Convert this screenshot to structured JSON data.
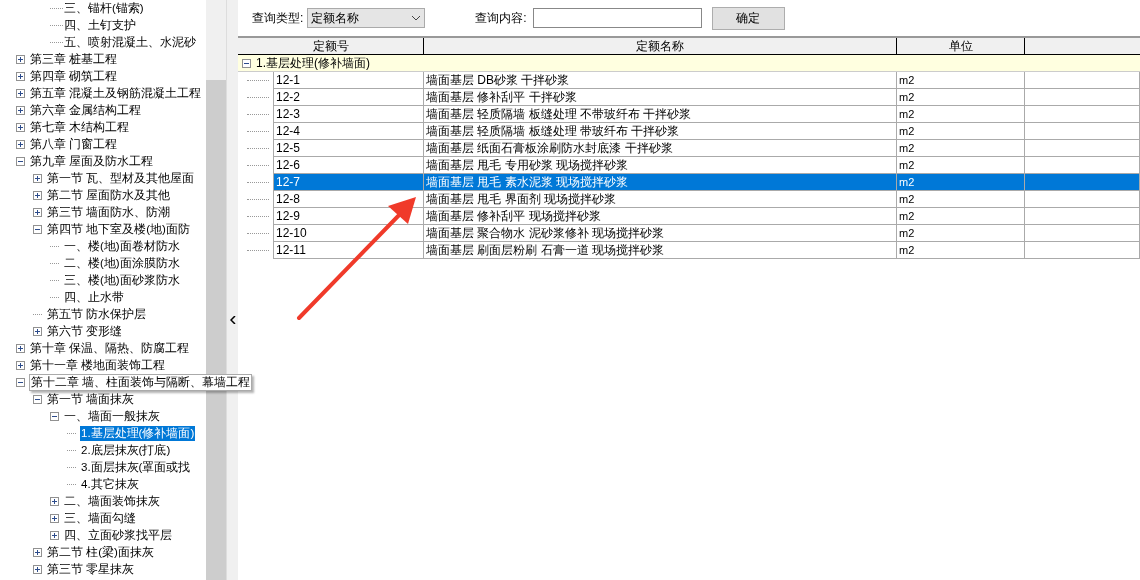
{
  "tree": {
    "scrolled_branch": [
      {
        "label": "三、锚杆(锚索)",
        "selected": false
      },
      {
        "label": "四、土钉支护",
        "selected": false
      },
      {
        "label": "五、喷射混凝土、水泥砂",
        "selected": false
      }
    ],
    "nodes": [
      {
        "label": "第三章 桩基工程",
        "expanded": false,
        "selected": false
      },
      {
        "label": "第四章 砌筑工程",
        "expanded": false,
        "selected": false
      },
      {
        "label": "第五章 混凝土及钢筋混凝土工程",
        "expanded": false,
        "selected": false
      },
      {
        "label": "第六章 金属结构工程",
        "expanded": false,
        "selected": false
      },
      {
        "label": "第七章 木结构工程",
        "expanded": false,
        "selected": false
      },
      {
        "label": "第八章 门窗工程",
        "expanded": false,
        "selected": false
      },
      {
        "label": "第九章 屋面及防水工程",
        "expanded": true,
        "selected": false,
        "children": [
          {
            "label": "第一节 瓦、型材及其他屋面",
            "expanded": false,
            "selected": false
          },
          {
            "label": "第二节 屋面防水及其他",
            "expanded": false,
            "selected": false
          },
          {
            "label": "第三节 墙面防水、防潮",
            "expanded": false,
            "selected": false
          },
          {
            "label": "第四节 地下室及楼(地)面防",
            "expanded": true,
            "selected": false,
            "children": [
              {
                "label": "一、楼(地)面卷材防水",
                "selected": false
              },
              {
                "label": "二、楼(地)面涂膜防水",
                "selected": false
              },
              {
                "label": "三、楼(地)面砂浆防水",
                "selected": false
              },
              {
                "label": "四、止水带",
                "selected": false
              }
            ]
          },
          {
            "label": "第五节 防水保护层",
            "selected": false
          },
          {
            "label": "第六节 变形缝",
            "expanded": false,
            "selected": false
          }
        ]
      },
      {
        "label": "第十章 保温、隔热、防腐工程",
        "expanded": false,
        "selected": false
      },
      {
        "label": "第十一章 楼地面装饰工程",
        "expanded": false,
        "selected": false
      },
      {
        "label": "第十二章 墙、柱面装饰与隔断、幕墙工程",
        "expanded": true,
        "selected": false,
        "tooltip": true,
        "children": [
          {
            "label": "第一节 墙面抹灰",
            "expanded": true,
            "selected": false,
            "children": [
              {
                "label": "一、墙面一般抹灰",
                "expanded": true,
                "selected": false,
                "children": [
                  {
                    "label": "1.基层处理(修补墙面)",
                    "selected": true
                  },
                  {
                    "label": "2.底层抹灰(打底)",
                    "selected": false
                  },
                  {
                    "label": "3.面层抹灰(罩面或找",
                    "selected": false
                  },
                  {
                    "label": "4.其它抹灰",
                    "selected": false
                  }
                ]
              },
              {
                "label": "二、墙面装饰抹灰",
                "expanded": false,
                "selected": false
              },
              {
                "label": "三、墙面勾缝",
                "expanded": false,
                "selected": false
              },
              {
                "label": "四、立面砂浆找平层",
                "expanded": false,
                "selected": false
              }
            ]
          },
          {
            "label": "第二节 柱(梁)面抹灰",
            "expanded": false,
            "selected": false
          },
          {
            "label": "第三节 零星抹灰",
            "expanded": false,
            "selected": false
          }
        ]
      }
    ]
  },
  "query": {
    "type_label": "查询类型:",
    "type_value": "定额名称",
    "content_label": "查询内容:",
    "confirm_button": "确定"
  },
  "table": {
    "columns": [
      "定额号",
      "定额名称",
      "单位"
    ],
    "group": {
      "label": "1.基层处理(修补墙面)",
      "expanded": true
    },
    "rows": [
      {
        "code": "12-1",
        "name": "墙面基层 DB砂浆 干拌砂浆",
        "unit": "m2",
        "selected": false
      },
      {
        "code": "12-2",
        "name": "墙面基层 修补刮平 干拌砂浆",
        "unit": "m2",
        "selected": false
      },
      {
        "code": "12-3",
        "name": "墙面基层 轻质隔墙 板缝处理 不带玻纤布 干拌砂浆",
        "unit": "m2",
        "selected": false
      },
      {
        "code": "12-4",
        "name": "墙面基层 轻质隔墙 板缝处理 带玻纤布 干拌砂浆",
        "unit": "m2",
        "selected": false
      },
      {
        "code": "12-5",
        "name": "墙面基层 纸面石膏板涂刷防水封底漆 干拌砂浆",
        "unit": "m2",
        "selected": false
      },
      {
        "code": "12-6",
        "name": "墙面基层 甩毛 专用砂浆 现场搅拌砂浆",
        "unit": "m2",
        "selected": false
      },
      {
        "code": "12-7",
        "name": "墙面基层 甩毛 素水泥浆 现场搅拌砂浆",
        "unit": "m2",
        "selected": true
      },
      {
        "code": "12-8",
        "name": "墙面基层 甩毛 界面剂 现场搅拌砂浆",
        "unit": "m2",
        "selected": false
      },
      {
        "code": "12-9",
        "name": "墙面基层 修补刮平 现场搅拌砂浆",
        "unit": "m2",
        "selected": false
      },
      {
        "code": "12-10",
        "name": "墙面基层 聚合物水 泥砂浆修补 现场搅拌砂浆",
        "unit": "m2",
        "selected": false
      },
      {
        "code": "12-11",
        "name": "墙面基层 刷面层粉刷 石膏一道 现场搅拌砂浆",
        "unit": "m2",
        "selected": false
      }
    ]
  }
}
